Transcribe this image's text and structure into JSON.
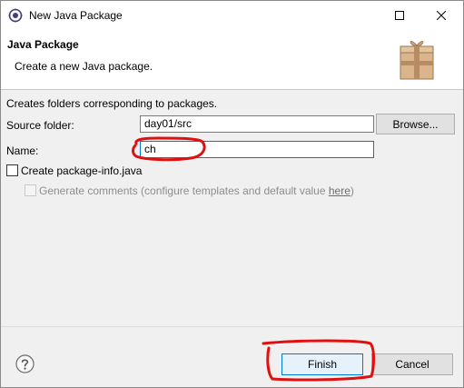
{
  "window": {
    "title": "New Java Package"
  },
  "banner": {
    "heading": "Java Package",
    "description": "Create a new Java package."
  },
  "form": {
    "info": "Creates folders corresponding to packages.",
    "source_folder_label": "Source folder:",
    "source_folder_value": "day01/src",
    "browse_label": "Browse...",
    "name_label": "Name:",
    "name_value": "ch",
    "create_package_info_label": "Create package-info.java",
    "create_package_info_checked": false,
    "generate_comments_label": "Generate comments (configure templates and default value ",
    "generate_comments_link": "here",
    "generate_comments_suffix": ")",
    "generate_comments_enabled": false
  },
  "footer": {
    "help_icon": "question-circle-icon",
    "finish_label": "Finish",
    "cancel_label": "Cancel"
  },
  "colors": {
    "accent": "#0078d7",
    "annotation": "#e01010"
  }
}
